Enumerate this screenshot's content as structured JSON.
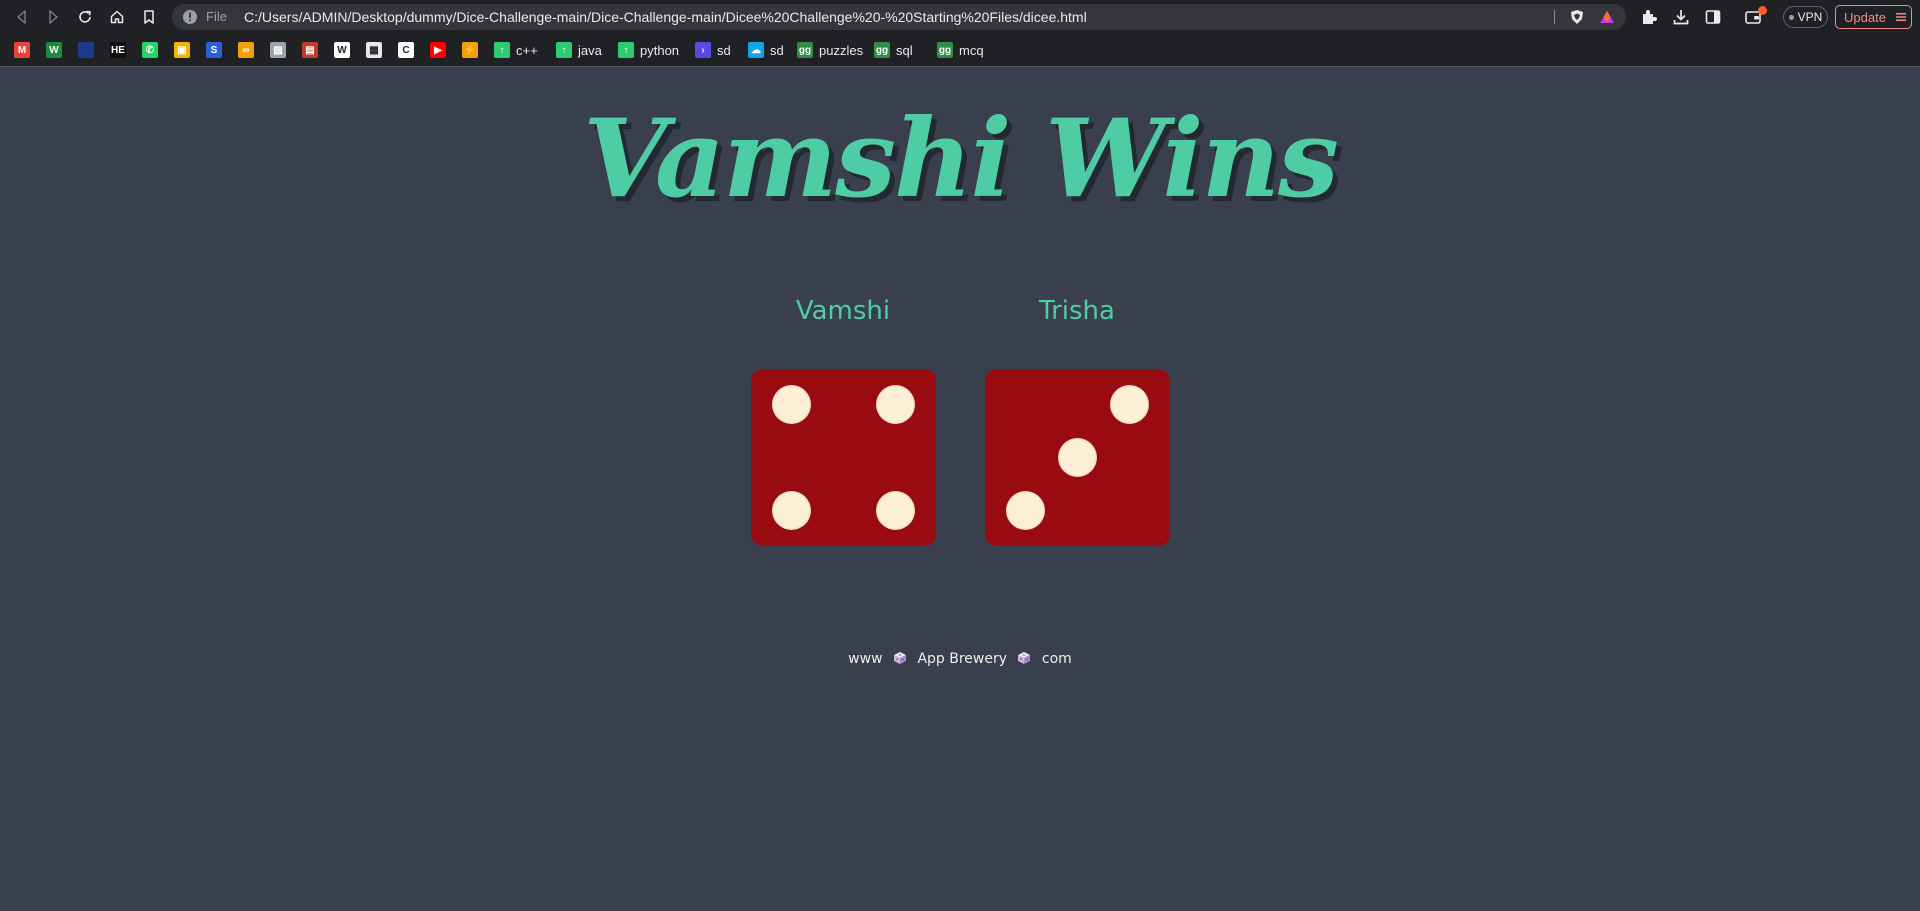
{
  "browser": {
    "url_scheme": "File",
    "url": "C:/Users/ADMIN/Desktop/dummy/Dice-Challenge-main/Dice-Challenge-main/Dicee%20Challenge%20-%20Starting%20Files/dicee.html",
    "vpn_label": "VPN",
    "update_label": "Update"
  },
  "bookmarks": [
    {
      "label": "",
      "icon": "gmail-icon",
      "color": "#ea4335",
      "glyph": "M"
    },
    {
      "label": "",
      "icon": "w-logo-icon",
      "color": "#1b8a3b",
      "glyph": "W"
    },
    {
      "label": "",
      "icon": "square-app-icon",
      "color": "#1e3a8a",
      "glyph": ""
    },
    {
      "label": "",
      "icon": "hackerearth-icon",
      "color": "#111111",
      "glyph": "HE"
    },
    {
      "label": "",
      "icon": "whatsapp-icon",
      "color": "#25d366",
      "glyph": "✆"
    },
    {
      "label": "",
      "icon": "photo-icon",
      "color": "#f4b400",
      "glyph": "▣"
    },
    {
      "label": "",
      "icon": "s-logo-icon",
      "color": "#2a62d4",
      "glyph": "S"
    },
    {
      "label": "",
      "icon": "infinity-icon",
      "color": "#f59e0b",
      "glyph": "∞"
    },
    {
      "label": "",
      "icon": "image-icon",
      "color": "#9ca3af",
      "glyph": "▨"
    },
    {
      "label": "",
      "icon": "book-icon",
      "color": "#c0392b",
      "glyph": "▤"
    },
    {
      "label": "",
      "icon": "wikipedia-icon",
      "color": "#ffffff",
      "glyph": "W"
    },
    {
      "label": "",
      "icon": "calendar-icon",
      "color": "#e5e7eb",
      "glyph": "▦"
    },
    {
      "label": "",
      "icon": "c-logo-icon",
      "color": "#ffffff",
      "glyph": "C"
    },
    {
      "label": "",
      "icon": "youtube-icon",
      "color": "#ff0000",
      "glyph": "▶"
    },
    {
      "label": "",
      "icon": "bolt-icon",
      "color": "#f59e0b",
      "glyph": "⚡"
    },
    {
      "label": "c++",
      "icon": "leetcode-icon",
      "color": "#2ecc71",
      "glyph": "↑"
    },
    {
      "label": "java",
      "icon": "leetcode-icon",
      "color": "#2ecc71",
      "glyph": "↑"
    },
    {
      "label": "python",
      "icon": "leetcode-icon",
      "color": "#2ecc71",
      "glyph": "↑"
    },
    {
      "label": "sd",
      "icon": "terminal-icon",
      "color": "#5b47e6",
      "glyph": "›"
    },
    {
      "label": "sd",
      "icon": "cloud-icon",
      "color": "#0ea5e9",
      "glyph": "☁"
    },
    {
      "label": "puzzles",
      "icon": "gfg-icon",
      "color": "#2f8d46",
      "glyph": "gg"
    },
    {
      "label": "sql",
      "icon": "gfg-icon",
      "color": "#2f8d46",
      "glyph": "gg"
    },
    {
      "label": "mcq",
      "icon": "gfg-icon",
      "color": "#2f8d46",
      "glyph": "gg"
    }
  ],
  "page": {
    "title": "Vamshi Wins",
    "player1": {
      "name": "Vamshi",
      "roll": 4
    },
    "player2": {
      "name": "Trisha",
      "roll": 3
    },
    "footer": {
      "part1": "www",
      "part2": "App Brewery",
      "part3": "com"
    },
    "colors": {
      "accent": "#4ecca3",
      "background": "#393f4d",
      "die": "#990b11",
      "pip": "#fdefd5"
    }
  }
}
